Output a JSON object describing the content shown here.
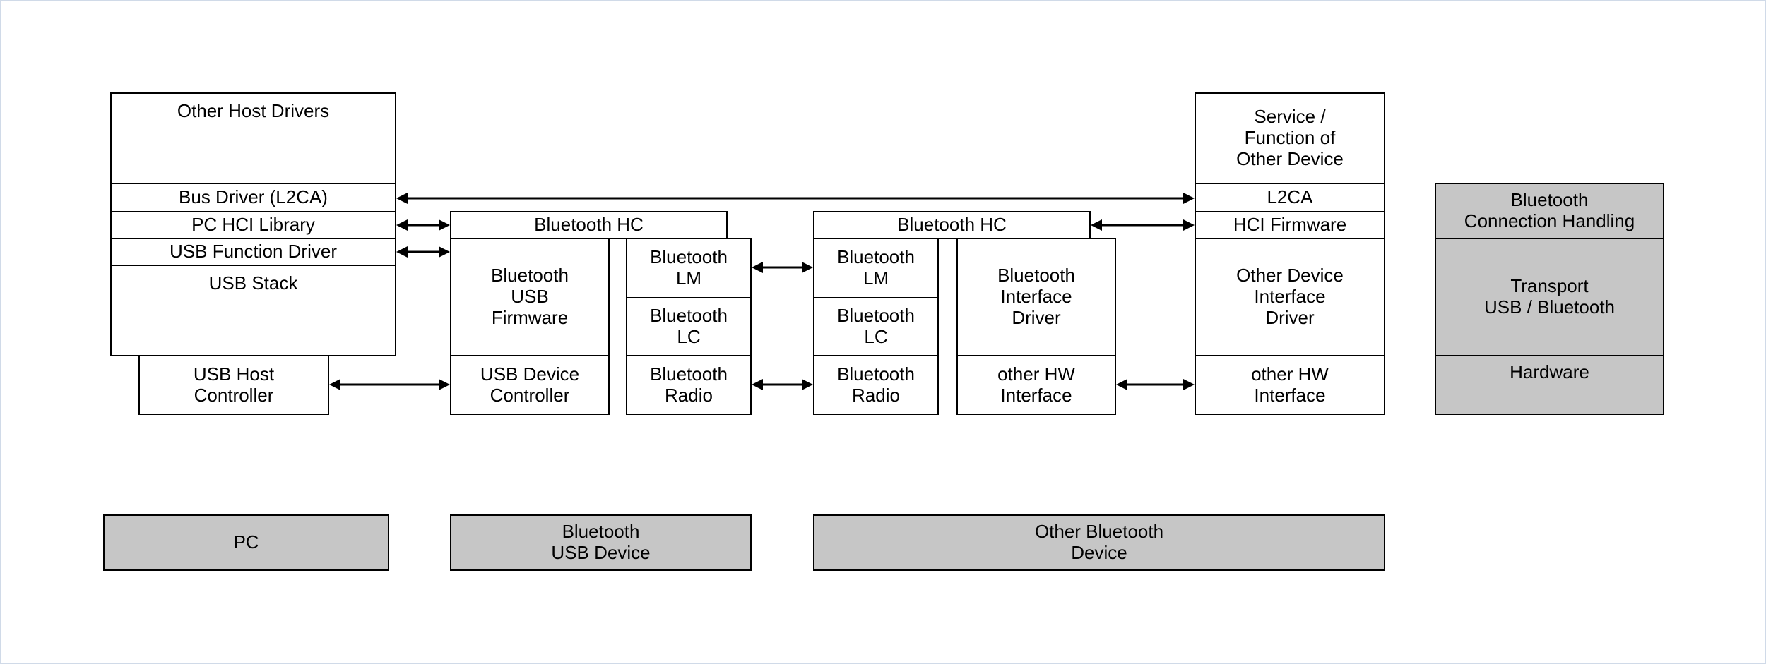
{
  "pc": {
    "other_host_drivers": "Other Host Drivers",
    "bus_driver": "Bus Driver (L2CA)",
    "pc_hci_library": "PC HCI Library",
    "usb_function_driver": "USB Function Driver",
    "usb_stack": "USB Stack",
    "usb_host_controller": "USB Host\nController"
  },
  "bt_usb_device": {
    "bluetooth_hc": "Bluetooth HC",
    "bt_usb_firmware": "Bluetooth\nUSB\nFirmware",
    "bt_lm": "Bluetooth\nLM",
    "bt_lc": "Bluetooth\nLC",
    "usb_device_controller": "USB Device\nController",
    "bt_radio": "Bluetooth\nRadio"
  },
  "other_bt_device": {
    "bluetooth_hc": "Bluetooth HC",
    "bt_lm": "Bluetooth\nLM",
    "bt_lc": "Bluetooth\nLC",
    "bt_interface_driver": "Bluetooth\nInterface\nDriver",
    "bt_radio": "Bluetooth\nRadio",
    "other_hw_interface": "other HW\nInterface"
  },
  "other_device": {
    "service": "Service /\nFunction of\nOther Device",
    "l2ca": "L2CA",
    "hci_firmware": "HCI Firmware",
    "other_device_interface_driver": "Other Device\nInterface\nDriver",
    "other_hw_interface": "other HW\nInterface"
  },
  "legend": {
    "bt_conn_handling": "Bluetooth\nConnection Handling",
    "transport": "Transport\nUSB / Bluetooth",
    "hardware": "Hardware"
  },
  "footer": {
    "pc": "PC",
    "bt_usb_device": "Bluetooth\nUSB Device",
    "other_bt_device": "Other Bluetooth\nDevice"
  }
}
